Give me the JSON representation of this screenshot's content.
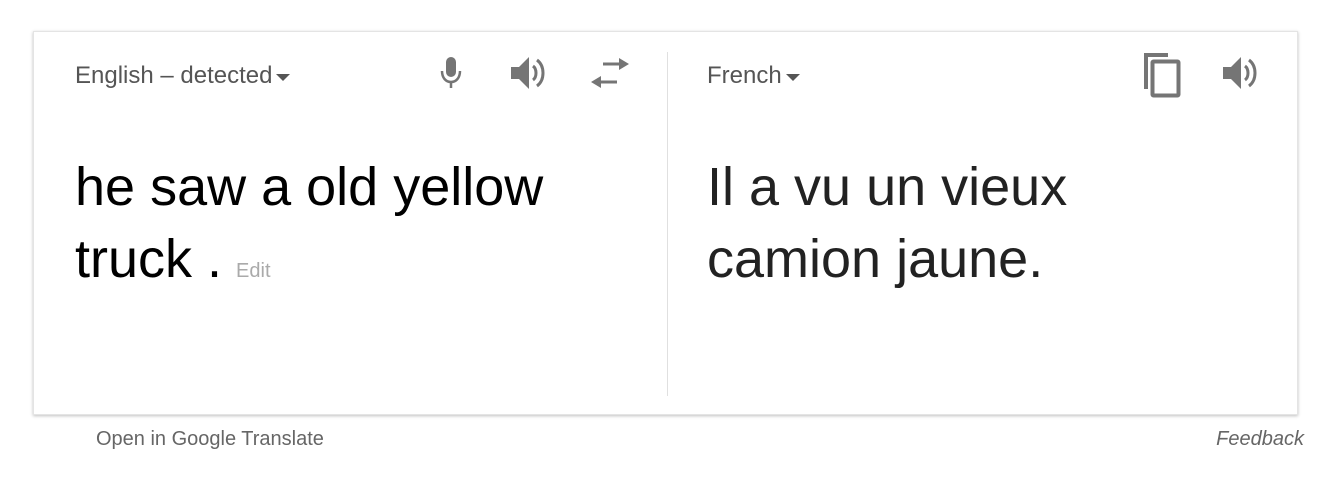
{
  "source": {
    "language_label": "English – detected",
    "text": "he saw a old yellow truck .",
    "edit_label": "Edit"
  },
  "target": {
    "language_label": "French",
    "text": "Il a vu un vieux camion jaune."
  },
  "icons": {
    "mic": "microphone-icon",
    "source_speaker": "speaker-icon",
    "swap": "swap-languages-icon",
    "copy": "copy-icon",
    "target_speaker": "speaker-icon"
  },
  "footer": {
    "open_link": "Open in Google Translate",
    "feedback_link": "Feedback"
  },
  "colors": {
    "icon_gray": "#757575",
    "label_gray": "#555555",
    "divider": "#e0e0e0"
  }
}
